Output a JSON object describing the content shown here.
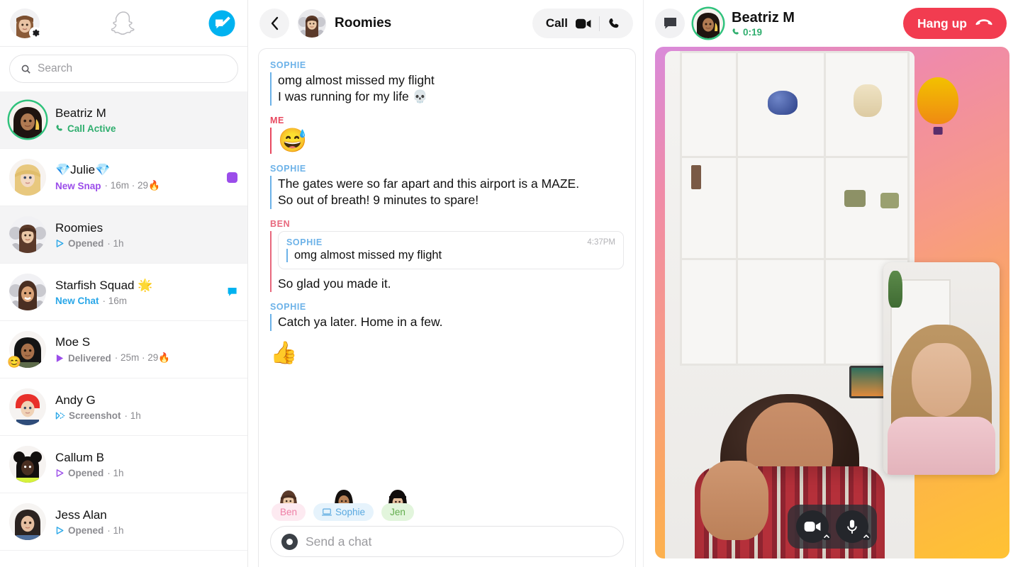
{
  "sidebar": {
    "profile_icon": "bitmoji-avatar",
    "settings_icon": "gear-icon",
    "logo_icon": "snapchat-ghost-logo",
    "new_chat_icon": "new-chat-icon",
    "search": {
      "placeholder": "Search",
      "icon": "search-icon"
    },
    "conversations": [
      {
        "name": "Beatriz M",
        "status": "Call Active",
        "status_color": "#2fae6e",
        "status_icon": "phone-icon",
        "meta": "",
        "active": true,
        "ring": true,
        "badge": "",
        "emoji": ""
      },
      {
        "name": "💎Julie💎",
        "status": "New Snap",
        "status_color": "#9b4dea",
        "status_icon": "",
        "meta": " · 16m · 29🔥",
        "active": false,
        "ring": false,
        "badge": "square-purple",
        "emoji": ""
      },
      {
        "name": "Roomies",
        "status": "Opened",
        "status_color": "#8b8b90",
        "status_icon": "arrow-outline-blue",
        "meta": " · 1h",
        "active": true,
        "ring": false,
        "badge": "",
        "emoji": ""
      },
      {
        "name": "Starfish Squad 🌟",
        "status": "New Chat",
        "status_color": "#2aa7e8",
        "status_icon": "",
        "meta": " · 16m",
        "active": false,
        "ring": false,
        "badge": "bubble-blue",
        "emoji": ""
      },
      {
        "name": "Moe S",
        "status": "Delivered",
        "status_color": "#8b8b90",
        "status_icon": "arrow-filled-purple",
        "meta": " · 25m · 29🔥",
        "active": false,
        "ring": false,
        "badge": "",
        "emoji": "😊"
      },
      {
        "name": "Andy G",
        "status": "Screenshot",
        "status_color": "#8b8b90",
        "status_icon": "screenshot-icon-blue",
        "meta": " · 1h",
        "active": false,
        "ring": false,
        "badge": "",
        "emoji": ""
      },
      {
        "name": "Callum B",
        "status": "Opened",
        "status_color": "#8b8b90",
        "status_icon": "arrow-outline-purple",
        "meta": " · 1h",
        "active": false,
        "ring": false,
        "badge": "",
        "emoji": ""
      },
      {
        "name": "Jess Alan",
        "status": "Opened",
        "status_color": "#8b8b90",
        "status_icon": "arrow-outline-blue",
        "meta": " · 1h",
        "active": false,
        "ring": false,
        "badge": "",
        "emoji": ""
      }
    ]
  },
  "chat": {
    "back_icon": "back-chevron-icon",
    "title": "Roomies",
    "call_label": "Call",
    "video_icon": "video-camera-icon",
    "phone_icon": "phone-icon",
    "messages": [
      {
        "sender": "SOPHIE",
        "color": "#6cb2e8",
        "lines": [
          "omg almost missed my flight",
          "I was running for my life 💀"
        ],
        "type": "text"
      },
      {
        "sender": "ME",
        "color": "#e8485f",
        "lines": [
          "😅"
        ],
        "type": "emoji"
      },
      {
        "sender": "SOPHIE",
        "color": "#6cb2e8",
        "lines": [
          "The gates were so far apart and this airport is a MAZE.",
          "So out of breath! 9 minutes to spare!"
        ],
        "type": "text"
      },
      {
        "sender": "BEN",
        "color": "#e8687d",
        "lines": [
          "So glad you made it."
        ],
        "type": "quote",
        "quote": {
          "sender": "SOPHIE",
          "color": "#6cb2e8",
          "time": "4:37PM",
          "text": "omg almost missed my flight"
        }
      },
      {
        "sender": "SOPHIE",
        "color": "#6cb2e8",
        "lines": [
          "Catch ya later. Home in a few."
        ],
        "type": "text"
      },
      {
        "sender": "",
        "color": "",
        "lines": [
          "👍"
        ],
        "type": "sticker"
      }
    ],
    "presence": [
      {
        "label": "Ben",
        "bg": "#fdeaf1",
        "fg": "#ef7fa6",
        "icon": ""
      },
      {
        "label": "Sophie",
        "bg": "#e6f3fc",
        "fg": "#5aa9e0",
        "icon": "laptop-icon"
      },
      {
        "label": "Jen",
        "bg": "#e2f5dc",
        "fg": "#63ad4e",
        "icon": ""
      }
    ],
    "composer": {
      "placeholder": "Send a chat",
      "icon": "camera-lens-icon"
    }
  },
  "call": {
    "chat_icon": "chat-bubble-icon",
    "name": "Beatriz M",
    "duration": "0:19",
    "duration_icon": "phone-icon",
    "hangup_label": "Hang up",
    "hangup_icon": "hangup-phone-icon",
    "hangup_color": "#f23c50",
    "controls": [
      {
        "icon": "video-camera-icon",
        "chevron": "chevron-up-icon"
      },
      {
        "icon": "microphone-icon",
        "chevron": "chevron-up-icon"
      }
    ]
  }
}
